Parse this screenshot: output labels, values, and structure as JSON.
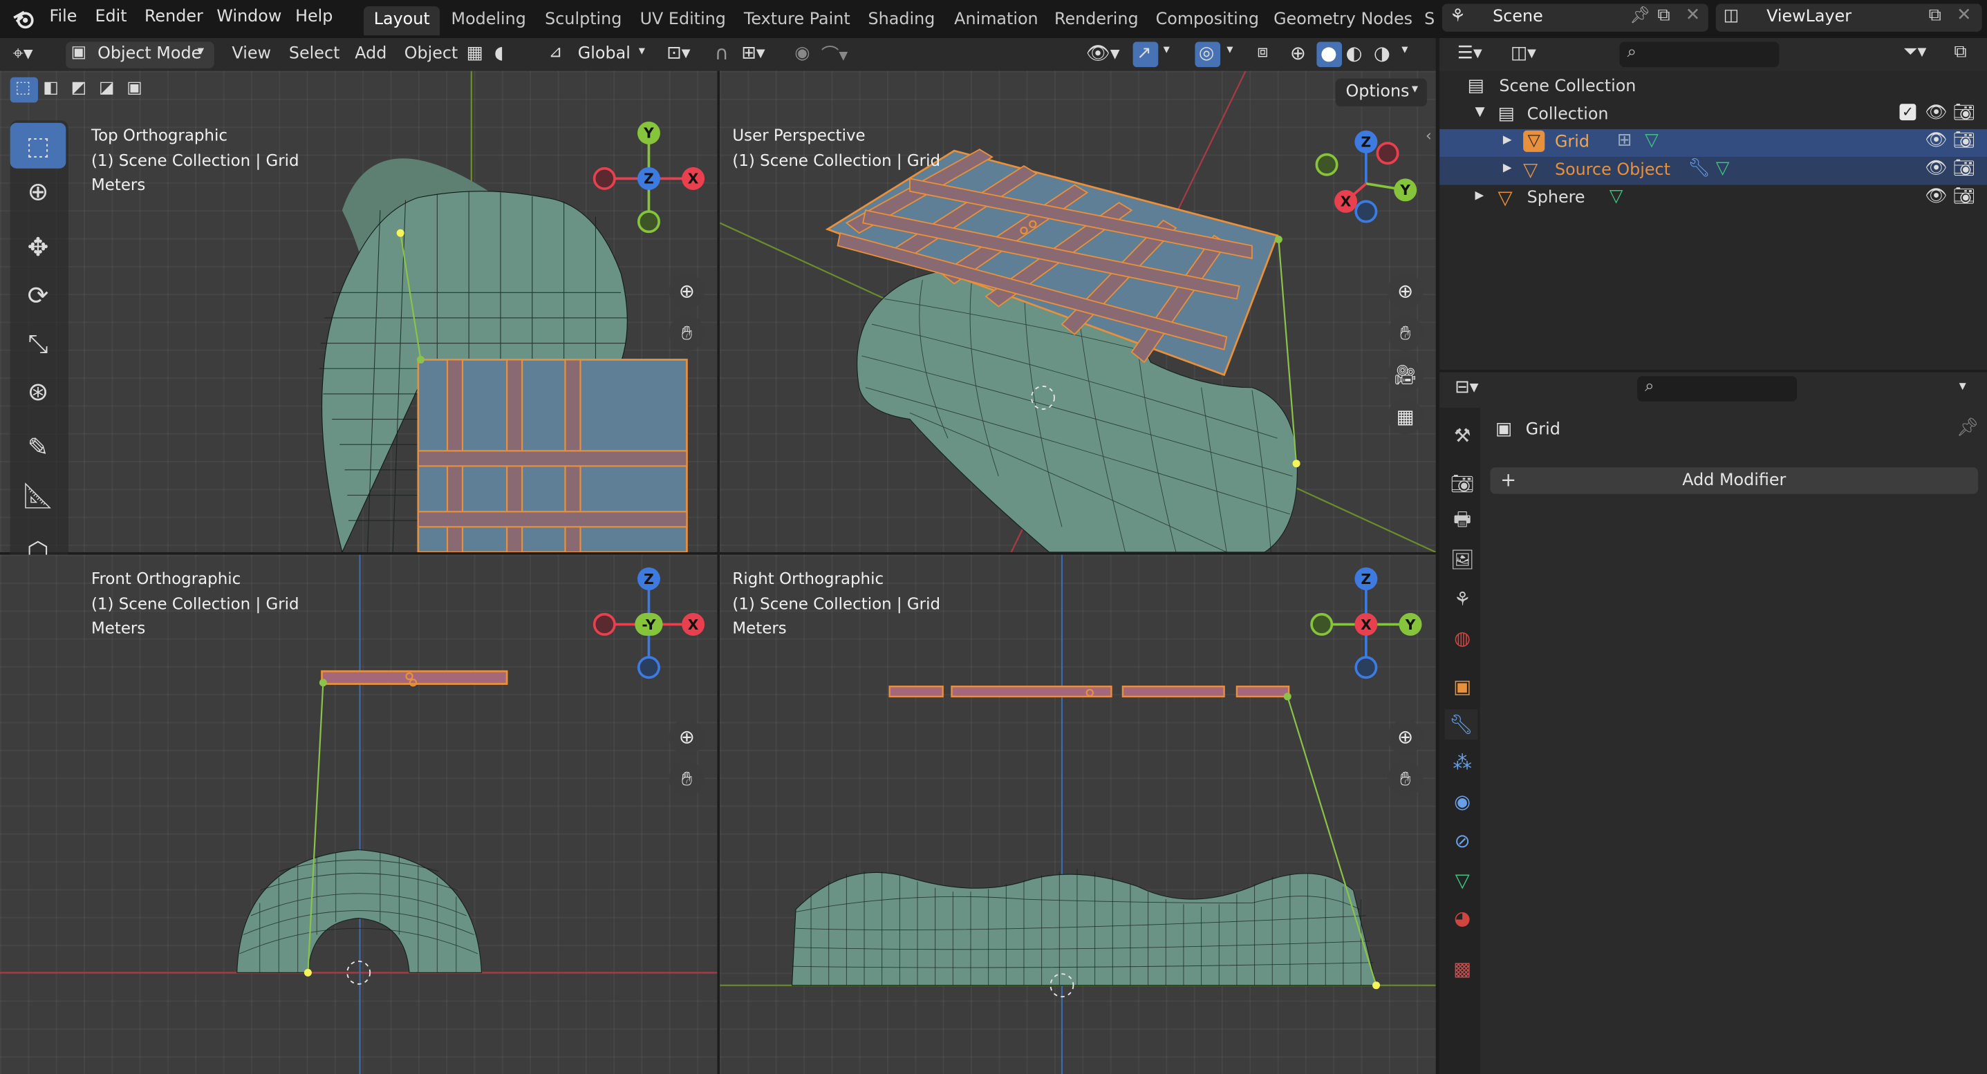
{
  "menus": [
    "File",
    "Edit",
    "Render",
    "Window",
    "Help"
  ],
  "workspaces": [
    "Layout",
    "Modeling",
    "Sculpting",
    "UV Editing",
    "Texture Paint",
    "Shading",
    "Animation",
    "Rendering",
    "Compositing",
    "Geometry Nodes",
    "S"
  ],
  "active_workspace": "Layout",
  "scene_name": "Scene",
  "view_layer": "ViewLayer",
  "viewport_header": {
    "mode": "Object Mode",
    "items": [
      "View",
      "Select",
      "Add",
      "Object"
    ],
    "transform_orientation": "Global",
    "options_label": "Options"
  },
  "viewports": {
    "top": {
      "title": "Top Orthographic",
      "context": "(1) Scene Collection | Grid",
      "units": "Meters"
    },
    "user": {
      "title": "User Perspective",
      "context": "(1) Scene Collection | Grid"
    },
    "front": {
      "title": "Front Orthographic",
      "context": "(1) Scene Collection | Grid",
      "units": "Meters"
    },
    "right": {
      "title": "Right Orthographic",
      "context": "(1) Scene Collection | Grid",
      "units": "Meters"
    }
  },
  "gizmo_labels": {
    "x": "X",
    "y": "Y",
    "z": "Z",
    "neg_y": "-Y"
  },
  "outliner": {
    "root": "Scene Collection",
    "collection": "Collection",
    "items": [
      {
        "name": "Grid",
        "selected": true,
        "color": "#e8a550"
      },
      {
        "name": "Source Object",
        "selected": true,
        "color": "#e8903c"
      },
      {
        "name": "Sphere",
        "selected": false,
        "color": "#dcdcdc"
      }
    ]
  },
  "properties": {
    "object_name": "Grid",
    "add_modifier_label": "Add Modifier"
  },
  "colors": {
    "accent": "#4772b3",
    "axis_x": "#e8404f",
    "axis_y": "#86c43b",
    "axis_z": "#3d7be0",
    "selection": "#e8903c",
    "mesh_fill": "#7fa89a"
  }
}
